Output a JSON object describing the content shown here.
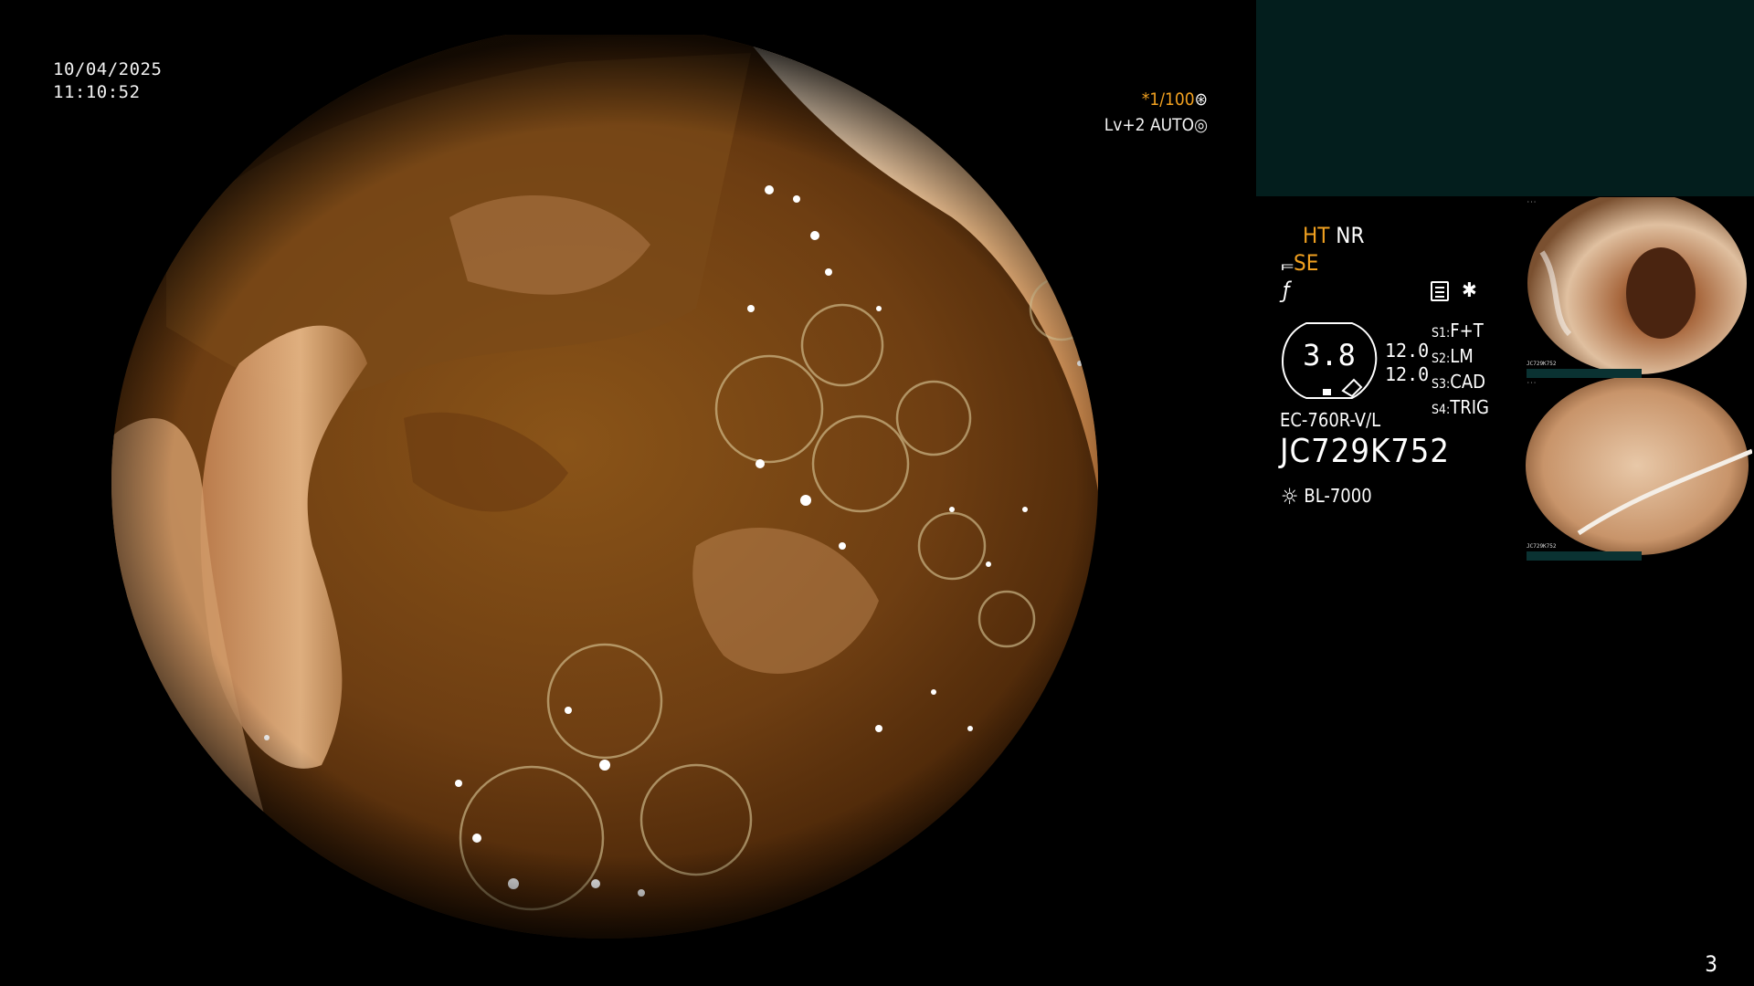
{
  "overlay": {
    "date": "10/04/2025",
    "time": "11:10:52",
    "shutter": "*1/100",
    "exposure": "Lv+2 AUTO"
  },
  "status": {
    "ht": "HT",
    "nr": "NR",
    "se": "SE",
    "scope_value": "3.8",
    "num_a": "12.0",
    "num_b": "12.0",
    "switches": [
      {
        "key": "S1:",
        "value": "F+T"
      },
      {
        "key": "S2:",
        "value": "LM"
      },
      {
        "key": "S3:",
        "value": "CAD"
      },
      {
        "key": "S4:",
        "value": "TRIG"
      }
    ],
    "scope_model": "EC-760R-V/L",
    "serial": "JC729K752",
    "light_source": "BL-7000"
  },
  "thumbnails": [
    {
      "label": "JC729K752"
    },
    {
      "label": "JC729K752"
    }
  ],
  "page_number": "3",
  "colors": {
    "accent_orange": "#f0a020",
    "panel_teal": "#031e1d"
  }
}
